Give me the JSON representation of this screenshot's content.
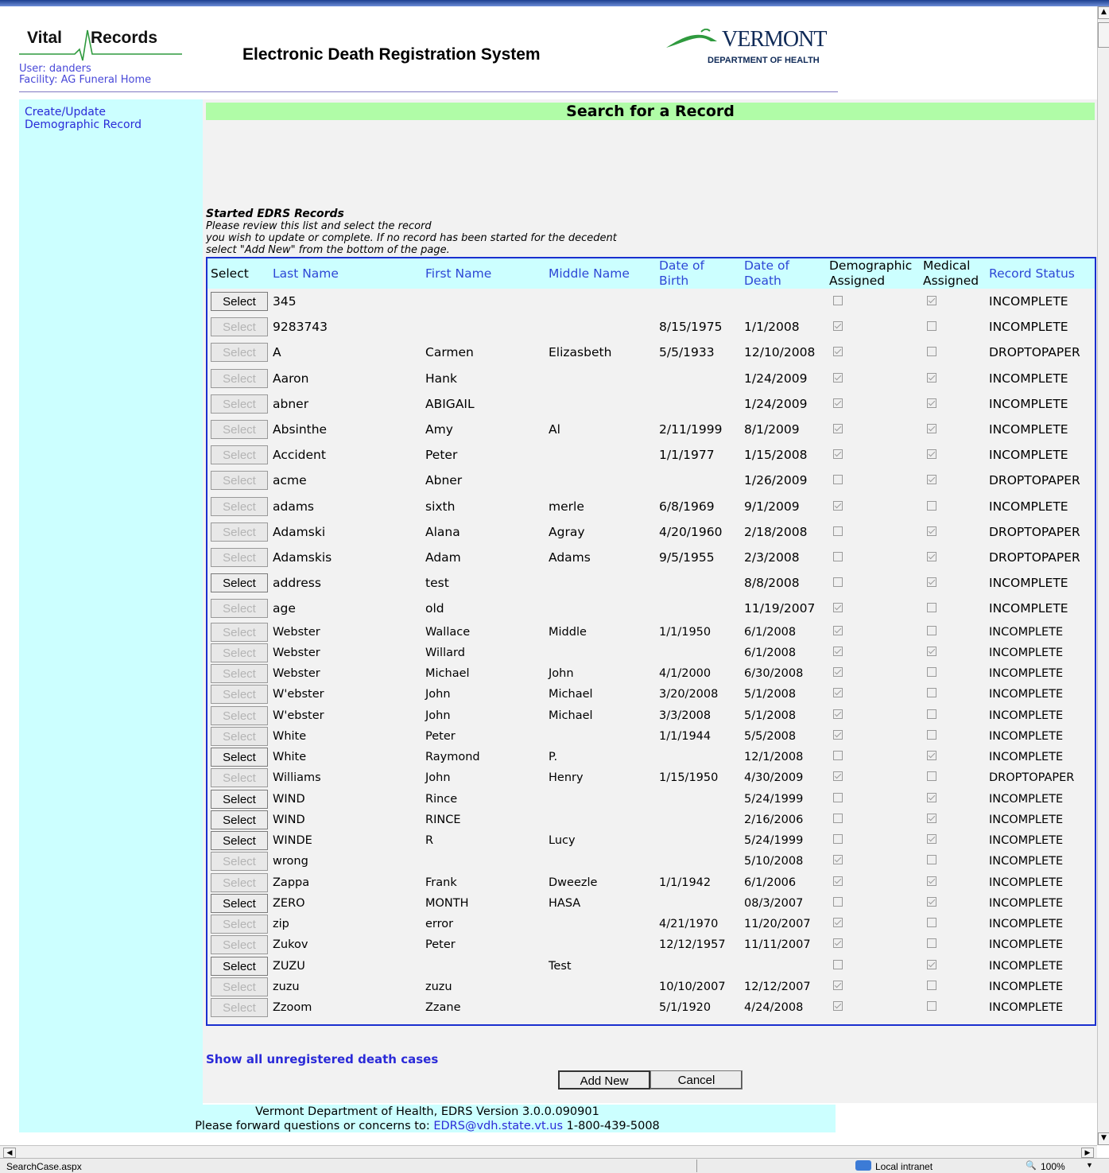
{
  "header": {
    "logo_text_1": "Vital",
    "logo_text_2": "Records",
    "user_line": "User: danders",
    "facility_line": "Facility: AG Funeral Home",
    "system_title": "Electronic Death Registration System",
    "vt_logo_word": "VERMONT",
    "vt_logo_dept": "DEPARTMENT OF HEALTH"
  },
  "sidebar": {
    "link_line1": "Create/Update",
    "link_line2": "Demographic Record"
  },
  "main": {
    "title": "Search for a Record",
    "intro_title": "Started EDRS Records",
    "intro_line1": "Please review this list and select the record",
    "intro_line2": "you wish to update or complete. If no record has been started for the decedent",
    "intro_line3": "select \"Add New\" from the bottom of the page.",
    "show_all_link": "Show all unregistered death cases",
    "add_new_label": "Add New",
    "cancel_label": "Cancel"
  },
  "table": {
    "columns": {
      "select": "Select",
      "last": "Last Name",
      "first": "First Name",
      "middle": "Middle Name",
      "dob_1": "Date of",
      "dob_2": "Birth",
      "dod_1": "Date of",
      "dod_2": "Death",
      "demo_1": "Demographic",
      "demo_2": "Assigned",
      "med_1": "Medical",
      "med_2": "Assigned",
      "status": "Record Status"
    },
    "select_label": "Select",
    "rows": [
      {
        "enabled": true,
        "last": "345",
        "first": "",
        "middle": "",
        "dob": "",
        "dod": "",
        "demo": false,
        "med": true,
        "status": "INCOMPLETE"
      },
      {
        "enabled": false,
        "last": "9283743",
        "first": "",
        "middle": "",
        "dob": "8/15/1975",
        "dod": "1/1/2008",
        "demo": true,
        "med": false,
        "status": "INCOMPLETE"
      },
      {
        "enabled": false,
        "last": "A",
        "first": "Carmen",
        "middle": "Elizasbeth",
        "dob": "5/5/1933",
        "dod": "12/10/2008",
        "demo": true,
        "med": false,
        "status": "DROPTOPAPER"
      },
      {
        "enabled": false,
        "last": "Aaron",
        "first": "Hank",
        "middle": "",
        "dob": "",
        "dod": "1/24/2009",
        "demo": true,
        "med": true,
        "status": "INCOMPLETE"
      },
      {
        "enabled": false,
        "last": "abner",
        "first": "ABIGAIL",
        "middle": "",
        "dob": "",
        "dod": "1/24/2009",
        "demo": true,
        "med": true,
        "status": "INCOMPLETE"
      },
      {
        "enabled": false,
        "last": "Absinthe",
        "first": "Amy",
        "middle": "Al",
        "dob": "2/11/1999",
        "dod": "8/1/2009",
        "demo": true,
        "med": true,
        "status": "INCOMPLETE"
      },
      {
        "enabled": false,
        "last": "Accident",
        "first": "Peter",
        "middle": "",
        "dob": "1/1/1977",
        "dod": "1/15/2008",
        "demo": true,
        "med": true,
        "status": "INCOMPLETE"
      },
      {
        "enabled": false,
        "last": "acme",
        "first": "Abner",
        "middle": "",
        "dob": "",
        "dod": "1/26/2009",
        "demo": false,
        "med": true,
        "status": "DROPTOPAPER"
      },
      {
        "enabled": false,
        "last": "adams",
        "first": "sixth",
        "middle": "merle",
        "dob": "6/8/1969",
        "dod": "9/1/2009",
        "demo": true,
        "med": false,
        "status": "INCOMPLETE"
      },
      {
        "enabled": false,
        "last": "Adamski",
        "first": "Alana",
        "middle": "Agray",
        "dob": "4/20/1960",
        "dod": "2/18/2008",
        "demo": false,
        "med": true,
        "status": "DROPTOPAPER"
      },
      {
        "enabled": false,
        "last": "Adamskis",
        "first": "Adam",
        "middle": "Adams",
        "dob": "9/5/1955",
        "dod": "2/3/2008",
        "demo": false,
        "med": true,
        "status": "DROPTOPAPER"
      },
      {
        "enabled": true,
        "last": "address",
        "first": "test",
        "middle": "",
        "dob": "",
        "dod": "8/8/2008",
        "demo": false,
        "med": true,
        "status": "INCOMPLETE"
      },
      {
        "enabled": false,
        "last": "age",
        "first": "old",
        "middle": "",
        "dob": "",
        "dod": "11/19/2007",
        "demo": true,
        "med": false,
        "status": "INCOMPLETE"
      },
      {
        "enabled": false,
        "last": "Webster",
        "first": "Wallace",
        "middle": "Middle",
        "dob": "1/1/1950",
        "dod": "6/1/2008",
        "demo": true,
        "med": false,
        "status": "INCOMPLETE"
      },
      {
        "enabled": false,
        "last": "Webster",
        "first": "Willard",
        "middle": "",
        "dob": "",
        "dod": "6/1/2008",
        "demo": true,
        "med": true,
        "status": "INCOMPLETE"
      },
      {
        "enabled": false,
        "last": "Webster",
        "first": "Michael",
        "middle": "John",
        "dob": "4/1/2000",
        "dod": "6/30/2008",
        "demo": true,
        "med": false,
        "status": "INCOMPLETE"
      },
      {
        "enabled": false,
        "last": "W'ebster",
        "first": "John",
        "middle": "Michael",
        "dob": "3/20/2008",
        "dod": "5/1/2008",
        "demo": true,
        "med": false,
        "status": "INCOMPLETE"
      },
      {
        "enabled": false,
        "last": "W'ebster",
        "first": "John",
        "middle": "Michael",
        "dob": "3/3/2008",
        "dod": "5/1/2008",
        "demo": true,
        "med": false,
        "status": "INCOMPLETE"
      },
      {
        "enabled": false,
        "last": "White",
        "first": "Peter",
        "middle": "",
        "dob": "1/1/1944",
        "dod": "5/5/2008",
        "demo": true,
        "med": false,
        "status": "INCOMPLETE"
      },
      {
        "enabled": true,
        "last": "White",
        "first": "Raymond",
        "middle": "P.",
        "dob": "",
        "dod": "12/1/2008",
        "demo": false,
        "med": true,
        "status": "INCOMPLETE"
      },
      {
        "enabled": false,
        "last": "Williams",
        "first": "John",
        "middle": "Henry",
        "dob": "1/15/1950",
        "dod": "4/30/2009",
        "demo": true,
        "med": false,
        "status": "DROPTOPAPER"
      },
      {
        "enabled": true,
        "last": "WIND",
        "first": "Rince",
        "middle": "",
        "dob": "",
        "dod": "5/24/1999",
        "demo": false,
        "med": true,
        "status": "INCOMPLETE"
      },
      {
        "enabled": true,
        "last": "WIND",
        "first": "RINCE",
        "middle": "",
        "dob": "",
        "dod": "2/16/2006",
        "demo": false,
        "med": true,
        "status": "INCOMPLETE"
      },
      {
        "enabled": true,
        "last": "WINDE",
        "first": "R",
        "middle": "Lucy",
        "dob": "",
        "dod": "5/24/1999",
        "demo": false,
        "med": true,
        "status": "INCOMPLETE"
      },
      {
        "enabled": false,
        "last": "wrong",
        "first": "",
        "middle": "",
        "dob": "",
        "dod": "5/10/2008",
        "demo": true,
        "med": false,
        "status": "INCOMPLETE"
      },
      {
        "enabled": false,
        "last": "Zappa",
        "first": "Frank",
        "middle": "Dweezle",
        "dob": "1/1/1942",
        "dod": "6/1/2006",
        "demo": true,
        "med": true,
        "status": "INCOMPLETE"
      },
      {
        "enabled": true,
        "last": "ZERO",
        "first": "MONTH",
        "middle": "HASA",
        "dob": "",
        "dod": "08/3/2007",
        "demo": false,
        "med": true,
        "status": "INCOMPLETE"
      },
      {
        "enabled": false,
        "last": "zip",
        "first": "error",
        "middle": "",
        "dob": "4/21/1970",
        "dod": "11/20/2007",
        "demo": true,
        "med": false,
        "status": "INCOMPLETE"
      },
      {
        "enabled": false,
        "last": "Zukov",
        "first": "Peter",
        "middle": "",
        "dob": "12/12/1957",
        "dod": "11/11/2007",
        "demo": true,
        "med": false,
        "status": "INCOMPLETE"
      },
      {
        "enabled": true,
        "last": "ZUZU",
        "first": "",
        "middle": "Test",
        "dob": "",
        "dod": "",
        "demo": false,
        "med": true,
        "status": "INCOMPLETE"
      },
      {
        "enabled": false,
        "last": "zuzu",
        "first": "zuzu",
        "middle": "",
        "dob": "10/10/2007",
        "dod": "12/12/2007",
        "demo": true,
        "med": false,
        "status": "INCOMPLETE"
      },
      {
        "enabled": false,
        "last": "Zzoom",
        "first": "Zzane",
        "middle": "",
        "dob": "5/1/1920",
        "dod": "4/24/2008",
        "demo": true,
        "med": false,
        "status": "INCOMPLETE"
      }
    ]
  },
  "footer": {
    "line1": "Vermont Department of Health, EDRS Version 3.0.0.090901",
    "line2_prefix": "Please forward questions or concerns to:",
    "email": "EDRS@vdh.state.vt.us",
    "phone": "1-800-439-5008"
  },
  "statusbar": {
    "page": "SearchCase.aspx",
    "zone": "Local intranet",
    "zoom": "100%"
  },
  "colors": {
    "sidebar_bg": "#ccffff",
    "title_bar": "#b0fca7",
    "table_border": "#1a2fcf",
    "link": "#2a2ad8"
  }
}
